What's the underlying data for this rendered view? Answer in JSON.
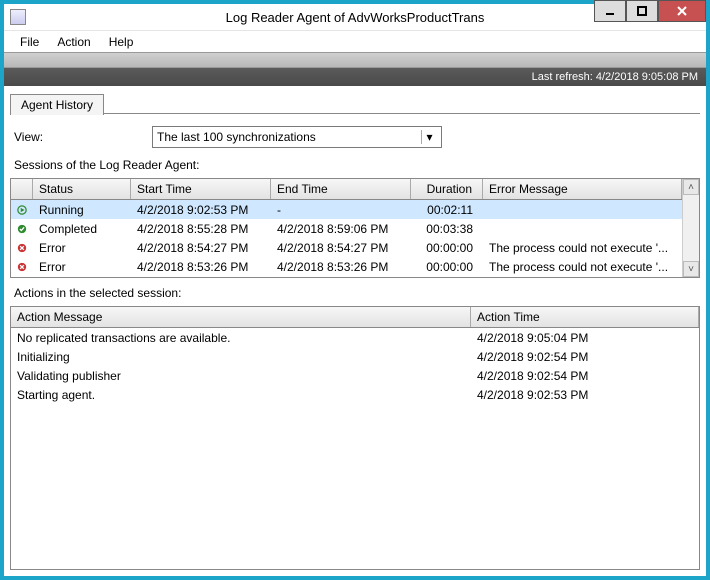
{
  "window": {
    "title": "Log Reader Agent of AdvWorksProductTrans"
  },
  "menu": {
    "file": "File",
    "action": "Action",
    "help": "Help"
  },
  "refresh_bar": "Last refresh: 4/2/2018 9:05:08 PM",
  "tab": "Agent History",
  "view": {
    "label": "View:",
    "selected": "The last 100 synchronizations"
  },
  "sessions": {
    "label": "Sessions of the Log Reader Agent:",
    "headers": {
      "status": "Status",
      "start": "Start Time",
      "end": "End Time",
      "duration": "Duration",
      "error": "Error Message"
    },
    "rows": [
      {
        "status": "Running",
        "icon": "running",
        "start": "4/2/2018 9:02:53 PM",
        "end": "-",
        "duration": "00:02:11",
        "error": ""
      },
      {
        "status": "Completed",
        "icon": "completed",
        "start": "4/2/2018 8:55:28 PM",
        "end": "4/2/2018 8:59:06 PM",
        "duration": "00:03:38",
        "error": ""
      },
      {
        "status": "Error",
        "icon": "error",
        "start": "4/2/2018 8:54:27 PM",
        "end": "4/2/2018 8:54:27 PM",
        "duration": "00:00:00",
        "error": "The process could not execute '..."
      },
      {
        "status": "Error",
        "icon": "error",
        "start": "4/2/2018 8:53:26 PM",
        "end": "4/2/2018 8:53:26 PM",
        "duration": "00:00:00",
        "error": "The process could not execute '..."
      }
    ]
  },
  "actions": {
    "label": "Actions in the selected session:",
    "headers": {
      "message": "Action Message",
      "time": "Action Time"
    },
    "rows": [
      {
        "message": "No replicated transactions are available.",
        "time": "4/2/2018 9:05:04 PM"
      },
      {
        "message": "Initializing",
        "time": "4/2/2018 9:02:54 PM"
      },
      {
        "message": "Validating publisher",
        "time": "4/2/2018 9:02:54 PM"
      },
      {
        "message": "Starting agent.",
        "time": "4/2/2018 9:02:53 PM"
      }
    ]
  }
}
